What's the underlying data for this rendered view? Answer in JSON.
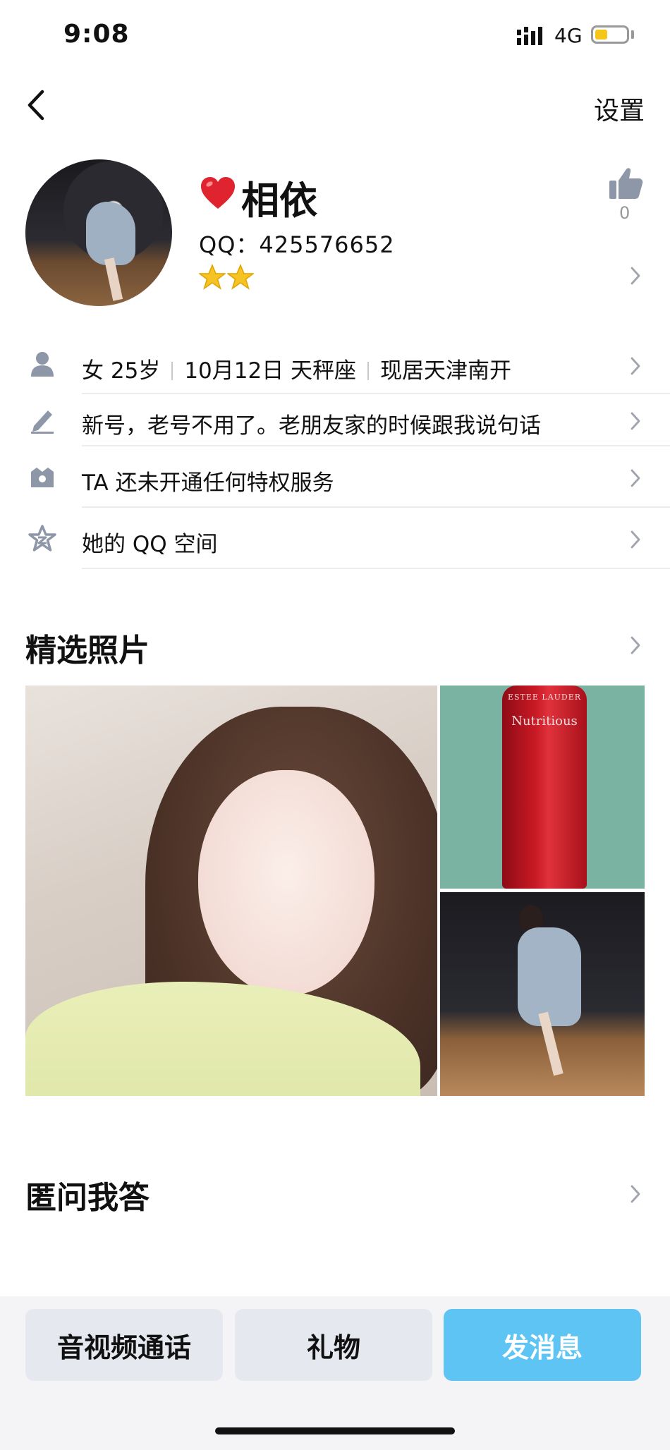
{
  "status_bar": {
    "time": "9:08",
    "network": "4G",
    "battery_level": 0.4,
    "battery_color": "#f5c518"
  },
  "nav": {
    "back_icon": "chevron-left-icon",
    "settings_label": "设置"
  },
  "profile": {
    "heart_icon": "red-heart-icon",
    "nickname": "相依",
    "qq_number": "QQ：425576652",
    "level_stars": 2,
    "like_icon": "thumbs-up-icon",
    "like_count": "0"
  },
  "info_rows": [
    {
      "icon": "person-icon",
      "parts": [
        "女 25岁",
        "10月12日 天秤座",
        "现居天津南开"
      ]
    },
    {
      "icon": "pencil-icon",
      "text": "新号，老号不用了。老朋友家的时候跟我说句话"
    },
    {
      "icon": "crown-icon",
      "text": "TA 还未开通任何特权服务"
    },
    {
      "icon": "qzone-star-icon",
      "text": "她的 QQ 空间"
    }
  ],
  "sections": {
    "photos_title": "精选照片",
    "qa_title": "匿问我答"
  },
  "photos": {
    "product_brand": "ESTEE LAUDER",
    "product_name": "Nutritious"
  },
  "bottom_bar": {
    "call_label": "音视频通话",
    "gift_label": "礼物",
    "message_label": "发消息",
    "accent_color": "#5ec4f4"
  }
}
